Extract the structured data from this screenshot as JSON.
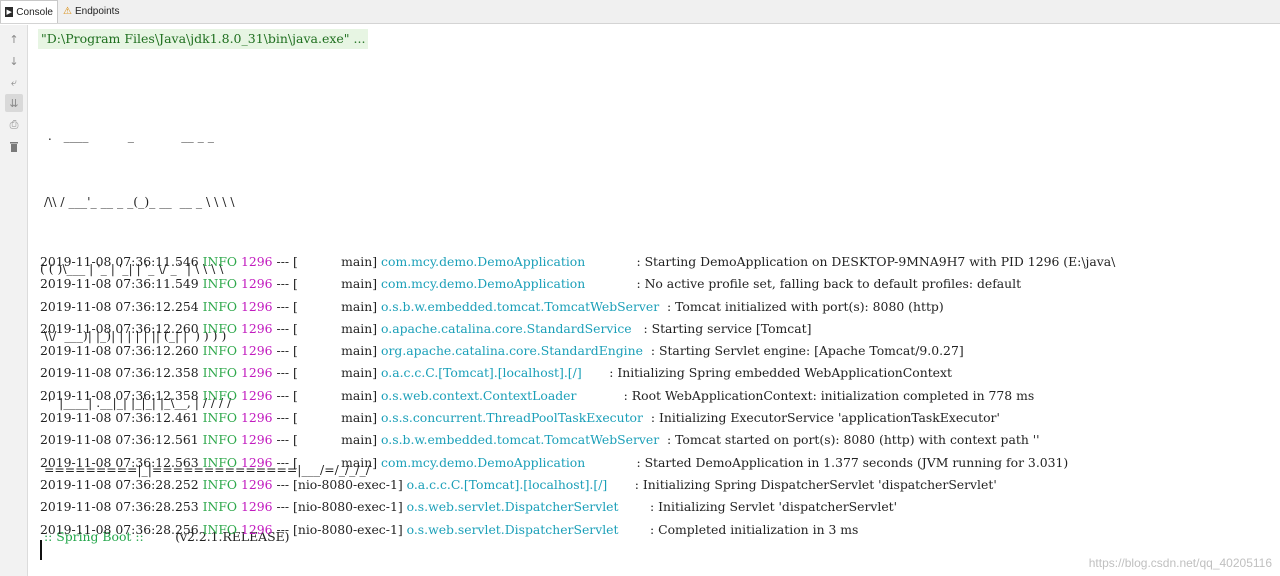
{
  "tabs": [
    {
      "label": "Console",
      "icon": "console-icon",
      "active": true
    },
    {
      "label": "Endpoints",
      "icon": "endpoints-icon",
      "active": false
    }
  ],
  "toolbar": [
    {
      "icon": "arrow-up-icon",
      "glyph": "↑"
    },
    {
      "icon": "arrow-down-icon",
      "glyph": "↓"
    },
    {
      "icon": "soft-wrap-icon",
      "glyph": "⤶"
    },
    {
      "icon": "scroll-to-end-icon",
      "glyph": "⇊"
    },
    {
      "icon": "print-icon",
      "glyph": "⎙"
    },
    {
      "icon": "trash-icon",
      "glyph": "🗑"
    }
  ],
  "command": "\"D:\\Program Files\\Java\\jdk1.8.0_31\\bin\\java.exe\" ...",
  "banner": [
    "  .   ____          _            __ _ _",
    " /\\\\ / ___'_ __ _ _(_)_ __  __ _ \\ \\ \\ \\",
    "( ( )\\___ | '_ | '_| | '_ \\/ _` | \\ \\ \\ \\",
    " \\\\/  ___)| |_)| | | | | || (_| |  ) ) ) )",
    "  '  |____| .__|_| |_|_| |_\\__, | / / / /",
    " =========|_|==============|___/=/_/_/_/"
  ],
  "boot_label": " :: Spring Boot :: ",
  "boot_version": "       (v2.2.1.RELEASE)",
  "logs": [
    {
      "ts": "2019-11-08 07:36:11.546",
      "level": "INFO",
      "pid": "1296",
      "thread": "[           main]",
      "logger": "com.mcy.demo.DemoApplication            ",
      "msg": "Starting DemoApplication on DESKTOP-9MNA9H7 with PID 1296 (E:\\java\\"
    },
    {
      "ts": "2019-11-08 07:36:11.549",
      "level": "INFO",
      "pid": "1296",
      "thread": "[           main]",
      "logger": "com.mcy.demo.DemoApplication            ",
      "msg": "No active profile set, falling back to default profiles: default"
    },
    {
      "ts": "2019-11-08 07:36:12.254",
      "level": "INFO",
      "pid": "1296",
      "thread": "[           main]",
      "logger": "o.s.b.w.embedded.tomcat.TomcatWebServer ",
      "msg": "Tomcat initialized with port(s): 8080 (http)"
    },
    {
      "ts": "2019-11-08 07:36:12.260",
      "level": "INFO",
      "pid": "1296",
      "thread": "[           main]",
      "logger": "o.apache.catalina.core.StandardService  ",
      "msg": "Starting service [Tomcat]"
    },
    {
      "ts": "2019-11-08 07:36:12.260",
      "level": "INFO",
      "pid": "1296",
      "thread": "[           main]",
      "logger": "org.apache.catalina.core.StandardEngine ",
      "msg": "Starting Servlet engine: [Apache Tomcat/9.0.27]"
    },
    {
      "ts": "2019-11-08 07:36:12.358",
      "level": "INFO",
      "pid": "1296",
      "thread": "[           main]",
      "logger": "o.a.c.c.C.[Tomcat].[localhost].[/]      ",
      "msg": "Initializing Spring embedded WebApplicationContext"
    },
    {
      "ts": "2019-11-08 07:36:12.358",
      "level": "INFO",
      "pid": "1296",
      "thread": "[           main]",
      "logger": "o.s.web.context.ContextLoader           ",
      "msg": "Root WebApplicationContext: initialization completed in 778 ms"
    },
    {
      "ts": "2019-11-08 07:36:12.461",
      "level": "INFO",
      "pid": "1296",
      "thread": "[           main]",
      "logger": "o.s.s.concurrent.ThreadPoolTaskExecutor ",
      "msg": "Initializing ExecutorService 'applicationTaskExecutor'"
    },
    {
      "ts": "2019-11-08 07:36:12.561",
      "level": "INFO",
      "pid": "1296",
      "thread": "[           main]",
      "logger": "o.s.b.w.embedded.tomcat.TomcatWebServer ",
      "msg": "Tomcat started on port(s): 8080 (http) with context path ''"
    },
    {
      "ts": "2019-11-08 07:36:12.563",
      "level": "INFO",
      "pid": "1296",
      "thread": "[           main]",
      "logger": "com.mcy.demo.DemoApplication            ",
      "msg": "Started DemoApplication in 1.377 seconds (JVM running for 3.031)"
    },
    {
      "ts": "2019-11-08 07:36:28.252",
      "level": "INFO",
      "pid": "1296",
      "thread": "[nio-8080-exec-1]",
      "logger": "o.a.c.c.C.[Tomcat].[localhost].[/]      ",
      "msg": "Initializing Spring DispatcherServlet 'dispatcherServlet'"
    },
    {
      "ts": "2019-11-08 07:36:28.253",
      "level": "INFO",
      "pid": "1296",
      "thread": "[nio-8080-exec-1]",
      "logger": "o.s.web.servlet.DispatcherServlet       ",
      "msg": "Initializing Servlet 'dispatcherServlet'"
    },
    {
      "ts": "2019-11-08 07:36:28.256",
      "level": "INFO",
      "pid": "1296",
      "thread": "[nio-8080-exec-1]",
      "logger": "o.s.web.servlet.DispatcherServlet       ",
      "msg": "Completed initialization in 3 ms"
    }
  ],
  "watermark": "https://blog.csdn.net/qq_40205116",
  "colors": {
    "info": "#2ea84b",
    "pid": "#c21bbf",
    "logger": "#1a9fb8",
    "boot": "#22a64a",
    "command_bg": "#e7f5e3"
  }
}
